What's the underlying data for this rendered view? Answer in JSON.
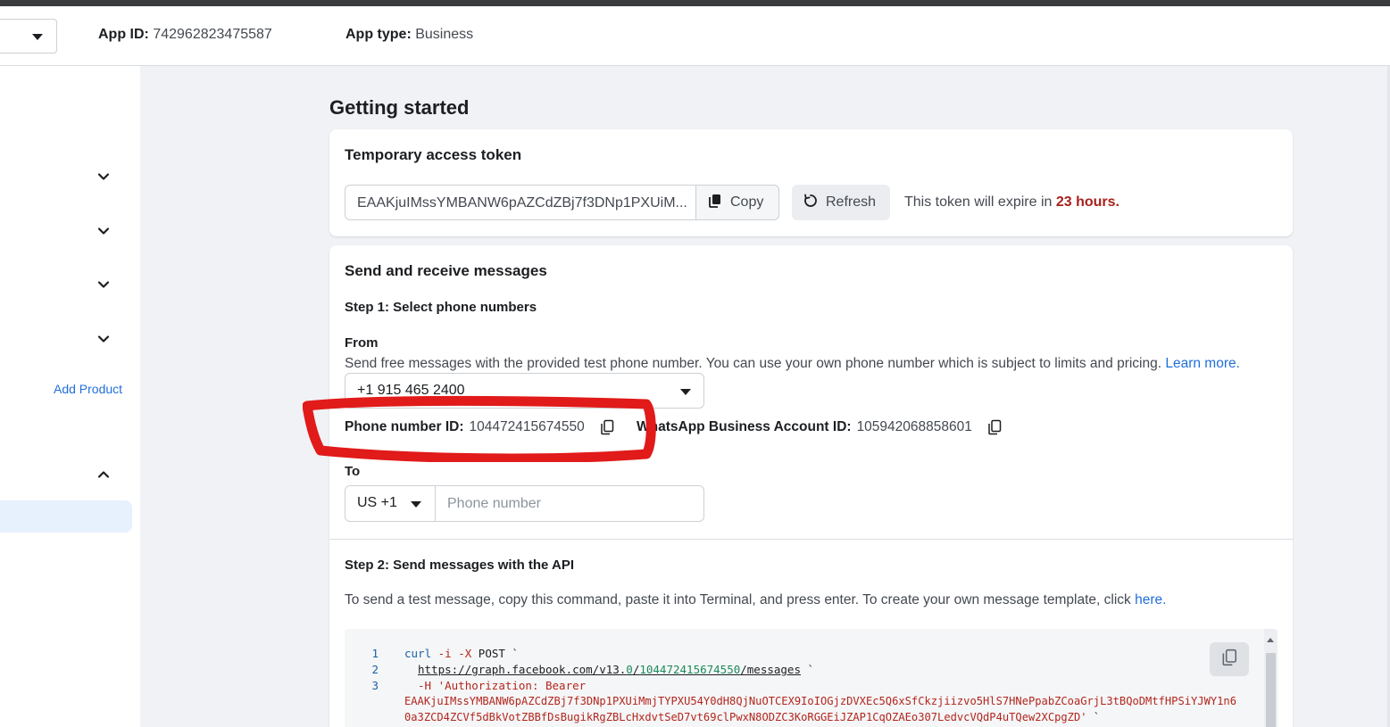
{
  "header": {
    "app_id_label": "App ID:",
    "app_id_value": "742962823475587",
    "app_type_label": "App type:",
    "app_type_value": "Business"
  },
  "sidebar": {
    "add_product": "Add Product"
  },
  "page": {
    "title": "Getting started"
  },
  "token_card": {
    "title": "Temporary access token",
    "token_value": "EAAKjuIMssYMBANW6pAZCdZBj7f3DNp1PXUiM...",
    "copy_label": "Copy",
    "refresh_label": "Refresh",
    "expire_prefix": "This token will expire in ",
    "expire_value": "23 hours."
  },
  "messages_card": {
    "title": "Send and receive messages",
    "step1_title": "Step 1: Select phone numbers",
    "from_label": "From",
    "from_desc": "Send free messages with the provided test phone number. You can use your own phone number which is subject to limits and pricing. ",
    "learn_more": "Learn more.",
    "from_number": "+1 915 465 2400",
    "phone_id_label": "Phone number ID:",
    "phone_id_value": "104472415674550",
    "waba_label": "WhatsApp Business Account ID:",
    "waba_value": "105942068858601",
    "to_label": "To",
    "to_country": "US +1",
    "to_placeholder": "Phone number",
    "step2_title": "Step 2: Send messages with the API",
    "step2_desc": "To send a test message, copy this command, paste it into Terminal, and press enter. To create your own message template, click ",
    "here_link": "here."
  },
  "code": {
    "line_numbers": [
      "1",
      "2",
      "3"
    ],
    "l1_cmd": "curl",
    "l1_flags": " -i -X",
    "l1_rest": " POST `",
    "l2_url_a": "https://graph.facebook.com/v13.",
    "l2_url_b": "0",
    "l2_url_c": "/",
    "l2_url_d": "104472415674550",
    "l2_url_e": "/messages",
    "l2_tail": " `",
    "l3_flag": "-H",
    "l3_text": " 'Authorization: Bearer",
    "l3_wrap1": "EAAKjuIMssYMBANW6pAZCdZBj7f3DNp1PXUiMmjTYPXU54Y0dH8QjNuOTCEX9IoIOGjzDVXEc5Q6xSfCkzjiizvo5HlS7HNePpabZCoaGrjL3tBQoDMtfHPSiYJWY1n6",
    "l3_wrap2": "0a3ZCD4ZCVf5dBkVotZBBfDsBugikRgZBLcHxdvtSeD7vt69clPwxN8ODZC3KoRGGEiJZAP1CqOZAEo307LedvcVQdP4uTQew2XCpgZD'",
    "l3_tail": " `"
  }
}
